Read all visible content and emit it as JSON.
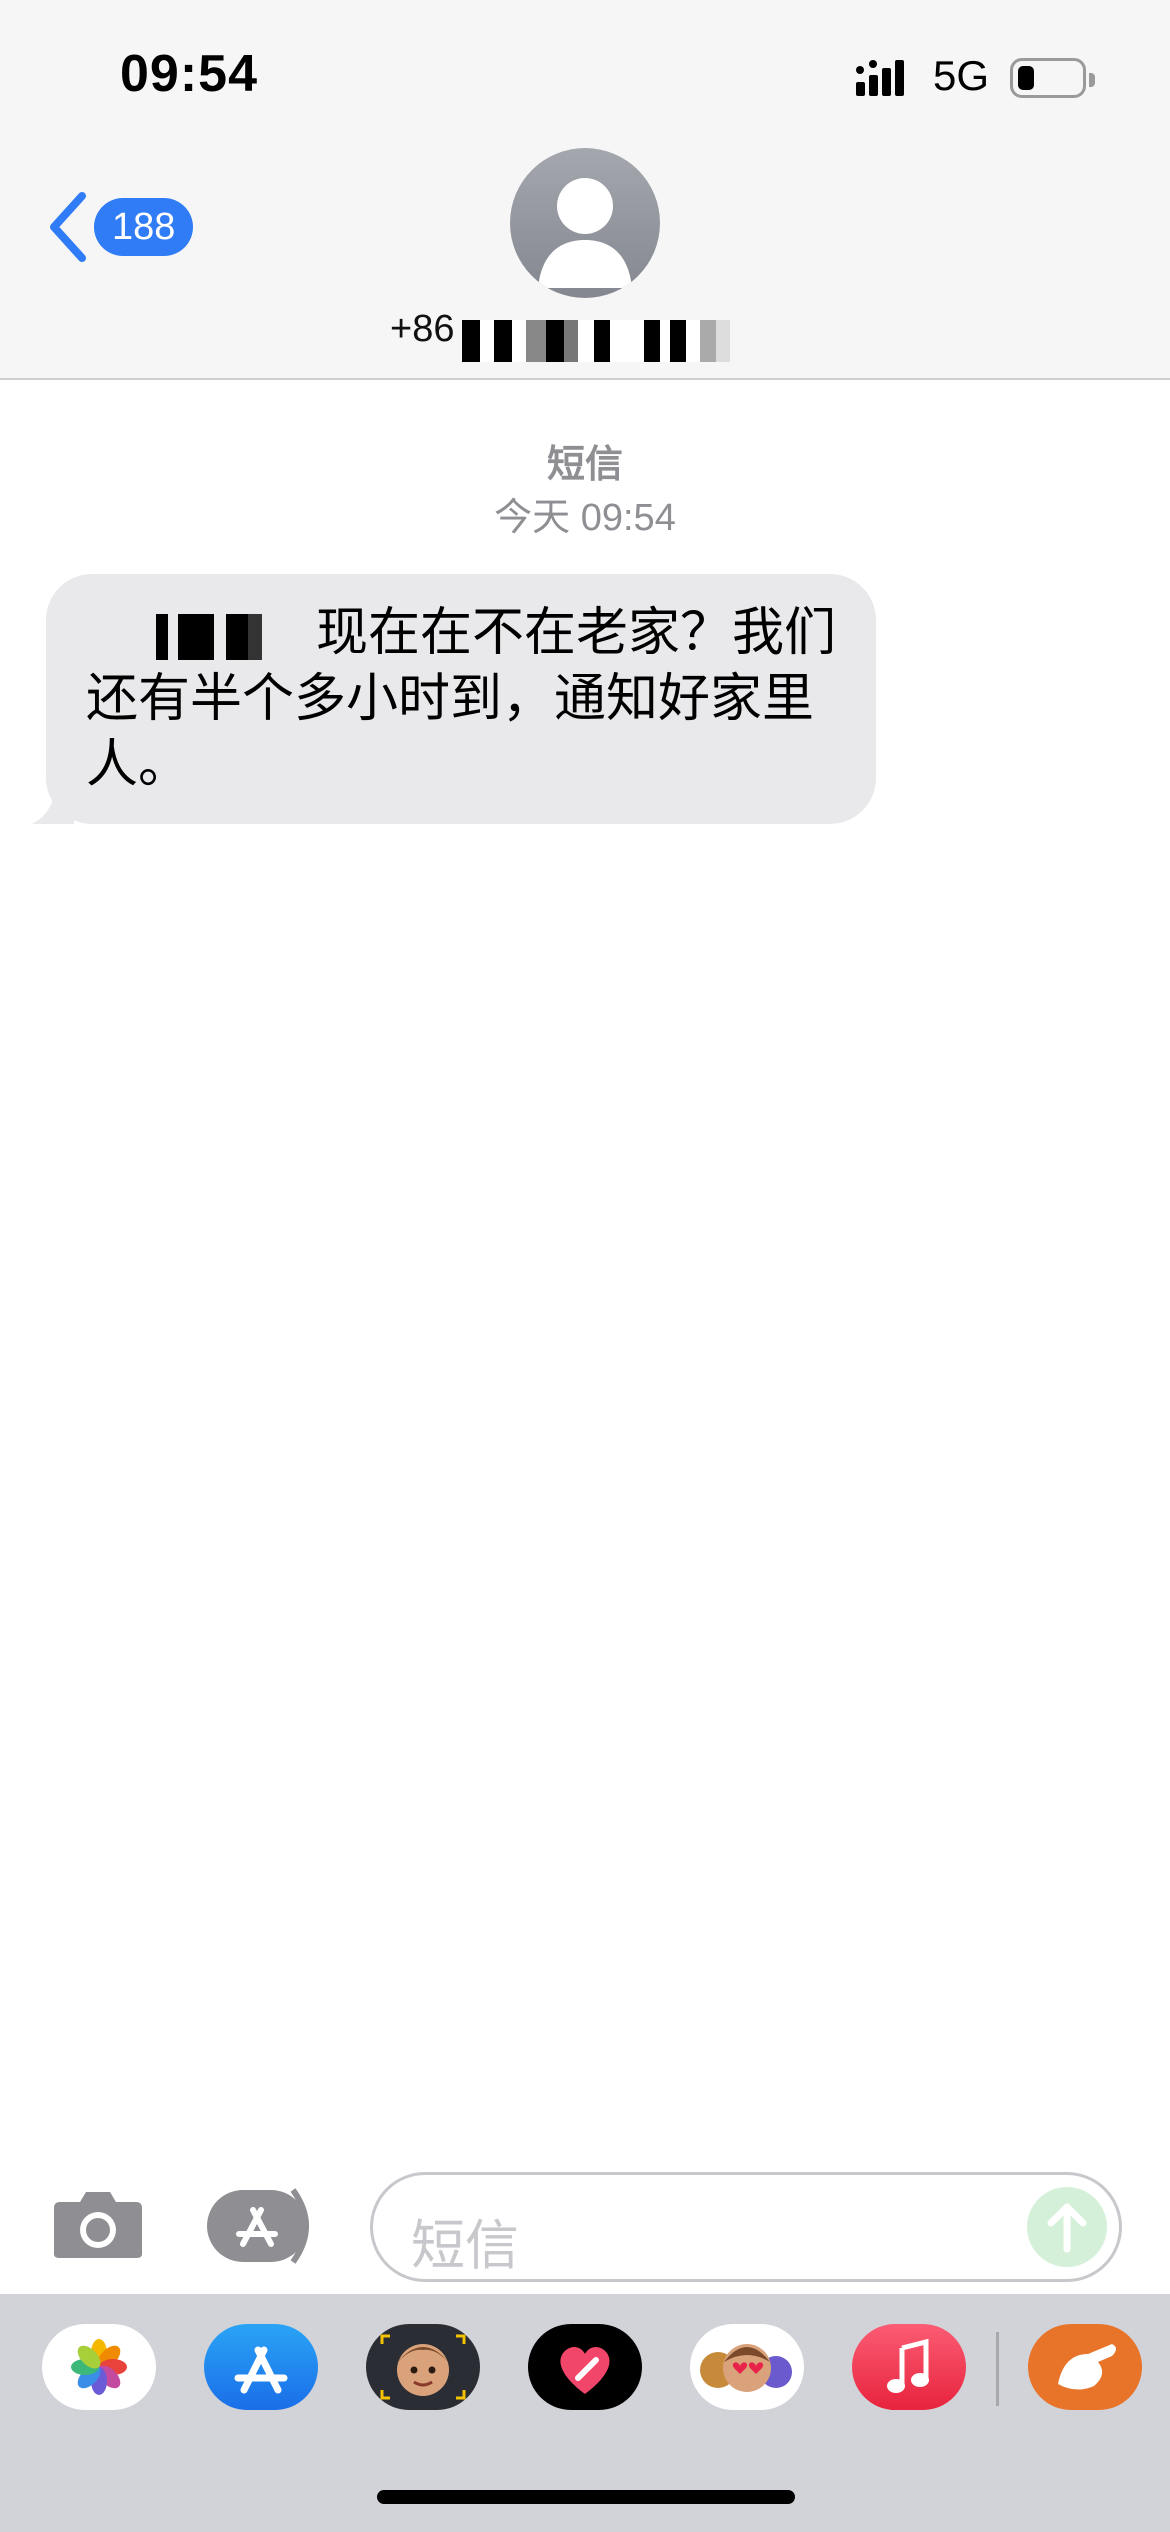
{
  "status_bar": {
    "time": "09:54",
    "network": "5G",
    "battery_level": 0.2
  },
  "header": {
    "back_badge": "188",
    "contact_prefix": "+86"
  },
  "conversation": {
    "message_type": "短信",
    "message_time": "今天 09:54",
    "messages": [
      {
        "direction": "incoming",
        "text": "现在在不在老家？我们还有半个多小时到，通知好家里人。"
      }
    ]
  },
  "composer": {
    "placeholder": "短信"
  },
  "app_drawer": {
    "apps": [
      "photos-app-icon",
      "app-store-app-icon",
      "memoji-sticker-app-icon",
      "digital-touch-app-icon",
      "animoji-app-icon",
      "music-app-icon",
      "third-party-app-icon"
    ]
  },
  "colors": {
    "accent": "#2f7cf6",
    "bubble_incoming": "#e9e9eb",
    "header_bg": "#f6f6f6",
    "drawer_bg": "#d1d3d8"
  }
}
